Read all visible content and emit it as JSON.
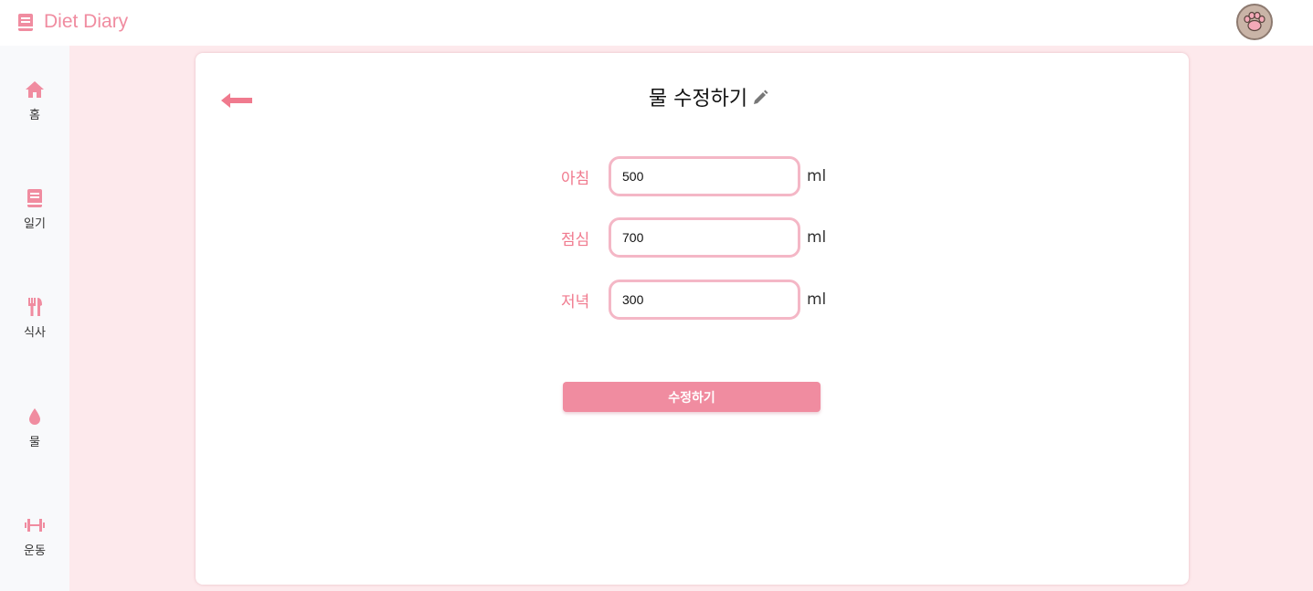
{
  "app": {
    "title": "Diet Diary"
  },
  "colors": {
    "accent": "#f08ca0",
    "label": "#f07a8e",
    "background": "#fde9ec",
    "input_border": "#f4b7c6"
  },
  "sidebar": {
    "items": [
      {
        "label": "홈",
        "icon": "home-icon"
      },
      {
        "label": "일기",
        "icon": "book-icon"
      },
      {
        "label": "식사",
        "icon": "utensils-icon"
      },
      {
        "label": "물",
        "icon": "water-drop-icon"
      },
      {
        "label": "운동",
        "icon": "dumbbell-icon"
      }
    ]
  },
  "header": {
    "avatar_icon": "paw-icon"
  },
  "page": {
    "title": "물 수정하기",
    "title_icon": "pencil-icon",
    "back_icon": "arrow-left-icon"
  },
  "form": {
    "rows": [
      {
        "label": "아침",
        "value": "500",
        "unit": "ml"
      },
      {
        "label": "점심",
        "value": "700",
        "unit": "ml"
      },
      {
        "label": "저녁",
        "value": "300",
        "unit": "ml"
      }
    ],
    "submit_label": "수정하기"
  }
}
